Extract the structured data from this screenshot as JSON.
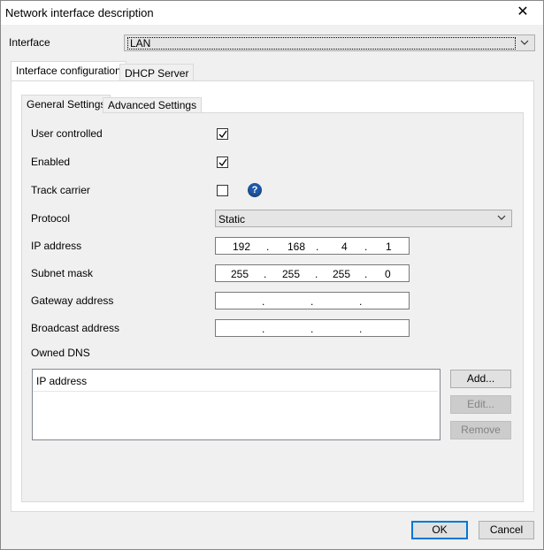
{
  "window": {
    "title": "Network interface description"
  },
  "interface": {
    "label": "Interface",
    "value": "LAN"
  },
  "outer_tabs": [
    "Interface configuration",
    "DHCP Server"
  ],
  "inner_tabs": [
    "General Settings",
    "Advanced Settings"
  ],
  "general": {
    "user_controlled": {
      "label": "User controlled",
      "checked": true
    },
    "enabled": {
      "label": "Enabled",
      "checked": true
    },
    "track_carrier": {
      "label": "Track carrier",
      "checked": false,
      "help_icon": "?"
    },
    "protocol": {
      "label": "Protocol",
      "value": "Static"
    },
    "ip_address": {
      "label": "IP address",
      "octets": [
        "192",
        "168",
        "4",
        "1"
      ]
    },
    "subnet_mask": {
      "label": "Subnet mask",
      "octets": [
        "255",
        "255",
        "255",
        "0"
      ]
    },
    "gateway_address": {
      "label": "Gateway address",
      "octets": [
        "",
        "",
        "",
        ""
      ]
    },
    "broadcast_address": {
      "label": "Broadcast address",
      "octets": [
        "",
        "",
        "",
        ""
      ]
    },
    "owned_dns": {
      "label": "Owned DNS",
      "column_header": "IP address",
      "add_button": "Add...",
      "edit_button": "Edit...",
      "remove_button": "Remove"
    }
  },
  "footer": {
    "ok": "OK",
    "cancel": "Cancel"
  },
  "dots": "."
}
